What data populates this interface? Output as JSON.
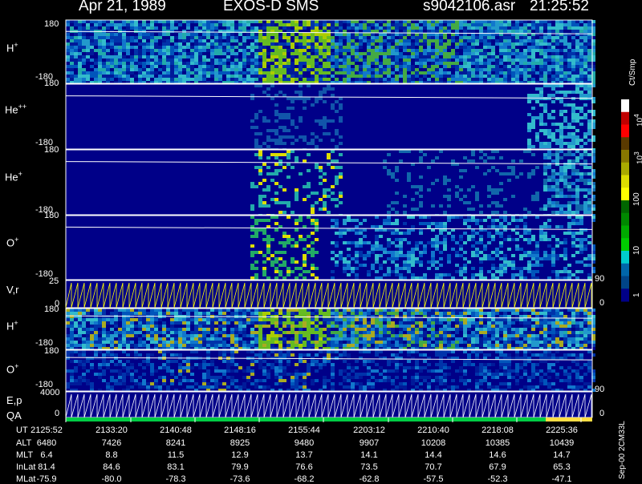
{
  "header": {
    "date": "Apr 21, 1989",
    "instrument": "EXOS-D SMS",
    "file": "s9042106.asr",
    "time": "21:25:52"
  },
  "panels": [
    {
      "id": "h-plus",
      "label": "H",
      "sup": "+",
      "top": "180",
      "bottom": "-180"
    },
    {
      "id": "he-pp",
      "label": "He",
      "sup": "++",
      "top": "180",
      "bottom": "-180"
    },
    {
      "id": "he-plus",
      "label": "He",
      "sup": "+",
      "top": "180",
      "bottom": "-180"
    },
    {
      "id": "o-plus",
      "label": "O",
      "sup": "+",
      "top": "180",
      "bottom": "-180"
    },
    {
      "id": "vr",
      "label": "V,r",
      "sup": "",
      "top": "25",
      "bottom": "0",
      "right_top": "90",
      "right_bottom": "0"
    },
    {
      "id": "h-plus-2",
      "label": "H",
      "sup": "+",
      "top": "180",
      "bottom": "-180"
    },
    {
      "id": "o-plus-2",
      "label": "O",
      "sup": "+",
      "top": "180",
      "bottom": "-180"
    },
    {
      "id": "ep",
      "label": "E,p",
      "sup": "",
      "top": "4000",
      "bottom": "0",
      "right_top": "90",
      "right_bottom": "0"
    }
  ],
  "qa_label": "QA",
  "colorbar": {
    "unit": "Ct/Smp",
    "ticks": [
      {
        "label": "10",
        "sup": "4"
      },
      {
        "label": "10",
        "sup": "3"
      },
      {
        "label": "100",
        "sup": ""
      },
      {
        "label": "10",
        "sup": ""
      },
      {
        "label": "1",
        "sup": ""
      }
    ],
    "colors": [
      "#ffffff",
      "#c00000",
      "#ff0000",
      "#5a3a00",
      "#887700",
      "#aaaa00",
      "#dddd00",
      "#ffff00",
      "#006600",
      "#008800",
      "#00aa00",
      "#00cc00",
      "#00cccc",
      "#0066aa",
      "#004488",
      "#000088"
    ]
  },
  "footer": {
    "row_labels": [
      "UT",
      "ALT",
      "MLT",
      "InLat",
      "MLat"
    ],
    "ut": [
      "2125:52",
      "2133:20",
      "2140:48",
      "2148:16",
      "2155:44",
      "2203:12",
      "2210:40",
      "2218:08",
      "2225:36"
    ],
    "alt": [
      "6480",
      "7426",
      "8241",
      "8925",
      "9480",
      "9907",
      "10208",
      "10385",
      "10439"
    ],
    "mlt": [
      "6.4",
      "8.8",
      "11.5",
      "12.9",
      "13.7",
      "14.1",
      "14.4",
      "14.6",
      "14.7"
    ],
    "inlat": [
      "81.4",
      "84.6",
      "83.1",
      "79.9",
      "76.6",
      "73.5",
      "70.7",
      "67.9",
      "65.3"
    ],
    "mlat": [
      "-75.9",
      "-80.0",
      "-78.3",
      "-73.6",
      "-68.2",
      "-62.8",
      "-57.5",
      "-52.3",
      "-47.1"
    ]
  },
  "stamp": "Sep-00 2CM33L",
  "chart_data": {
    "type": "heatmap",
    "title": "Apr 21, 1989 EXOS-D SMS",
    "x": [
      "2125:52",
      "2133:20",
      "2140:48",
      "2148:16",
      "2155:44",
      "2203:12",
      "2210:40",
      "2218:08",
      "2225:36"
    ],
    "series": [
      {
        "name": "H+",
        "ylim": [
          -180,
          180
        ]
      },
      {
        "name": "He++",
        "ylim": [
          -180,
          180
        ]
      },
      {
        "name": "He+",
        "ylim": [
          -180,
          180
        ]
      },
      {
        "name": "O+",
        "ylim": [
          -180,
          180
        ]
      },
      {
        "name": "V,r",
        "ylim": [
          0,
          25
        ]
      },
      {
        "name": "H+",
        "ylim": [
          -180,
          180
        ]
      },
      {
        "name": "O+",
        "ylim": [
          -180,
          180
        ]
      },
      {
        "name": "E,p",
        "ylim": [
          0,
          4000
        ]
      }
    ],
    "colorbar_unit": "Ct/Smp",
    "colorbar_range": [
      1,
      10000
    ]
  }
}
